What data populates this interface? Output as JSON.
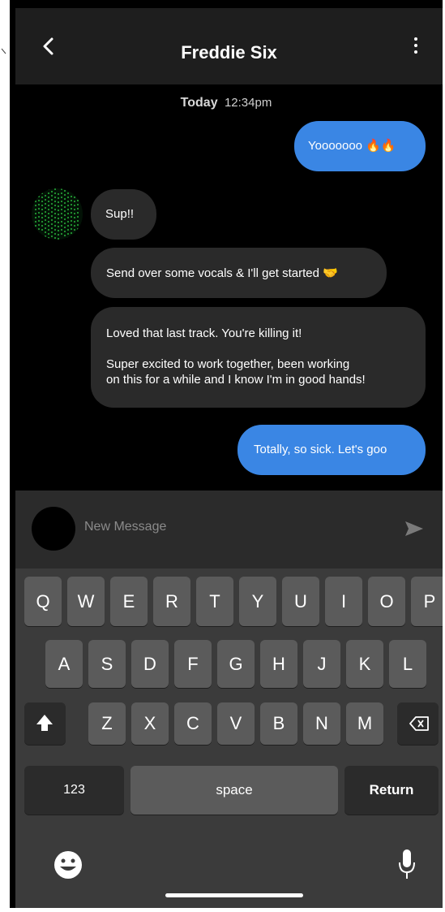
{
  "header": {
    "title": "Freddie Six"
  },
  "date": {
    "day": "Today",
    "time": "12:34pm"
  },
  "messages": [
    {
      "from": "me",
      "text": "Yooooooo 🔥🔥"
    },
    {
      "from": "them",
      "text": "Sup!!"
    },
    {
      "from": "them",
      "text": "Send over some vocals & I'll get started 🤝"
    },
    {
      "from": "them",
      "line1": "Loved that last track. You're killing it!",
      "line2": "Super excited to work together, been working",
      "line3": "on this for a while and I know I'm in good hands!"
    },
    {
      "from": "me",
      "text": "Totally, so sick. Let's goo"
    }
  ],
  "composer": {
    "placeholder": "New Message"
  },
  "keyboard": {
    "row1": [
      "Q",
      "W",
      "E",
      "R",
      "T",
      "Y",
      "U",
      "I",
      "O",
      "P"
    ],
    "row2": [
      "A",
      "S",
      "D",
      "F",
      "G",
      "H",
      "J",
      "K",
      "L"
    ],
    "row3": [
      "Z",
      "X",
      "C",
      "V",
      "B",
      "N",
      "M"
    ],
    "numbers_label": "123",
    "space_label": "space",
    "return_label": "Return"
  },
  "colors": {
    "outgoing": "#3a86e4",
    "incoming": "#2a2a2a",
    "header": "#1e1e1e",
    "keyboard": "#3b3b3b"
  }
}
